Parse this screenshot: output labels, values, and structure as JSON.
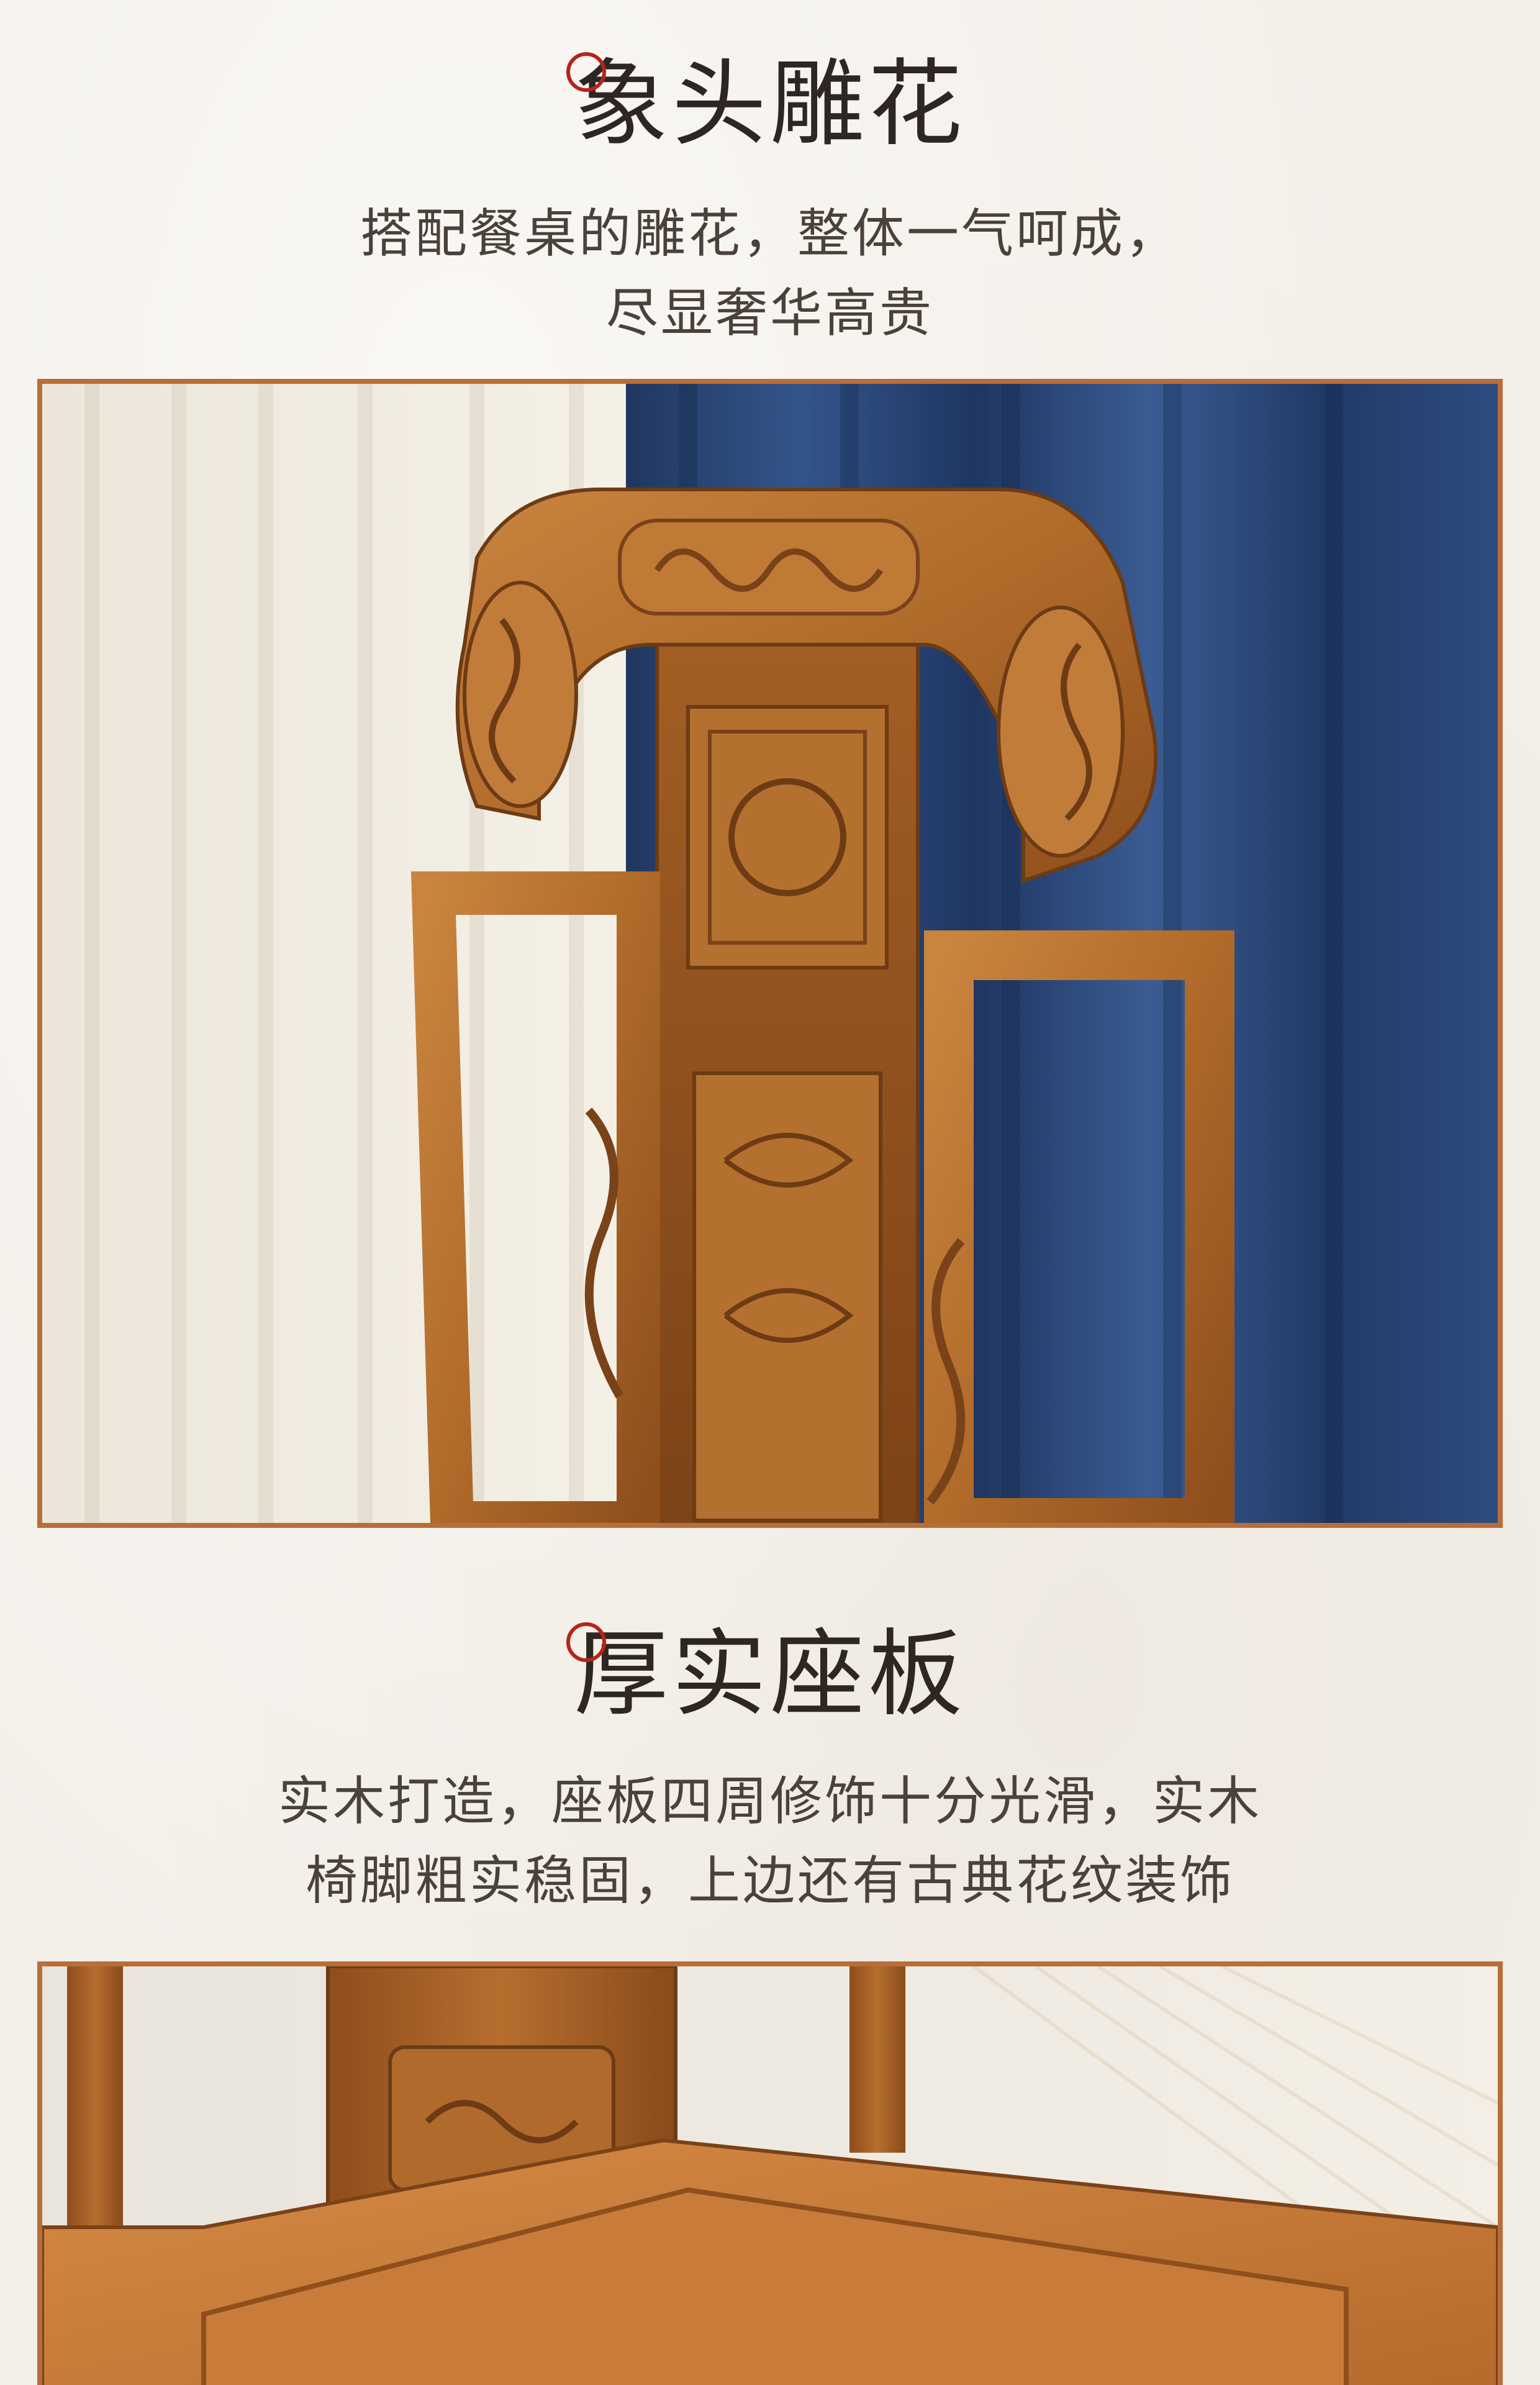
{
  "section1": {
    "title": "象头雕花",
    "subtitle_lines": [
      "搭配餐桌的雕花，整体一气呵成，",
      "尽显奢华高贵"
    ],
    "photo": {
      "subject": "carved-elephant-head-chair-back"
    }
  },
  "section2": {
    "title": "厚实座板",
    "subtitle_lines": [
      "实木打造，座板四周修饰十分光滑，实木",
      "椅脚粗实稳固，上边还有古典花纹装饰"
    ],
    "photo": {
      "subject": "thick-solid-wood-seat-board"
    }
  },
  "colors": {
    "background": "#f3efe9",
    "title_text": "#2e2622",
    "subtitle_text": "#4a413b",
    "accent_red": "#b5241b",
    "frame_border": "#b86e39",
    "wood": "#b8702e",
    "curtain_blue": "#243f6e"
  }
}
